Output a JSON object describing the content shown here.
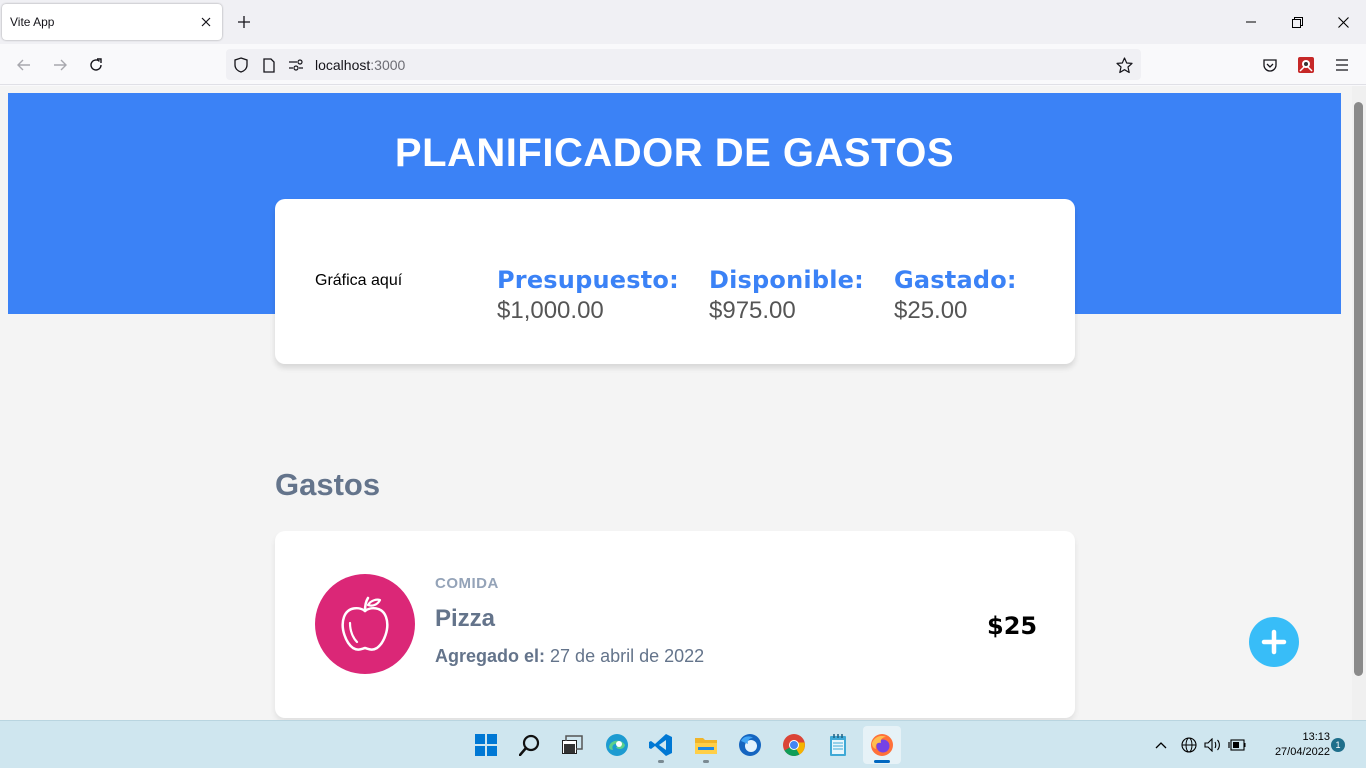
{
  "browser": {
    "tab_title": "Vite App",
    "url_host": "localhost",
    "url_port": ":3000"
  },
  "header": {
    "title": "PLANIFICADOR DE GASTOS"
  },
  "budget": {
    "chart_placeholder": "Gráfica aquí",
    "presupuesto_label": "Presupuesto:",
    "presupuesto_value": "$1,000.00",
    "disponible_label": "Disponible:",
    "disponible_value": "$975.00",
    "gastado_label": "Gastado:",
    "gastado_value": "$25.00"
  },
  "expenses": {
    "section_title": "Gastos",
    "items": [
      {
        "category": "COMIDA",
        "name": "Pizza",
        "date_label": "Agregado el:",
        "date_value": "27 de abril de 2022",
        "amount": "$25",
        "icon": "apple-icon",
        "icon_color": "#db2777"
      }
    ]
  },
  "colors": {
    "hero": "#3b82f6",
    "accent": "#3b82f6",
    "fab": "#38bdf8"
  },
  "taskbar": {
    "time": "13:13",
    "date": "27/04/2022",
    "notification_count": "1"
  }
}
